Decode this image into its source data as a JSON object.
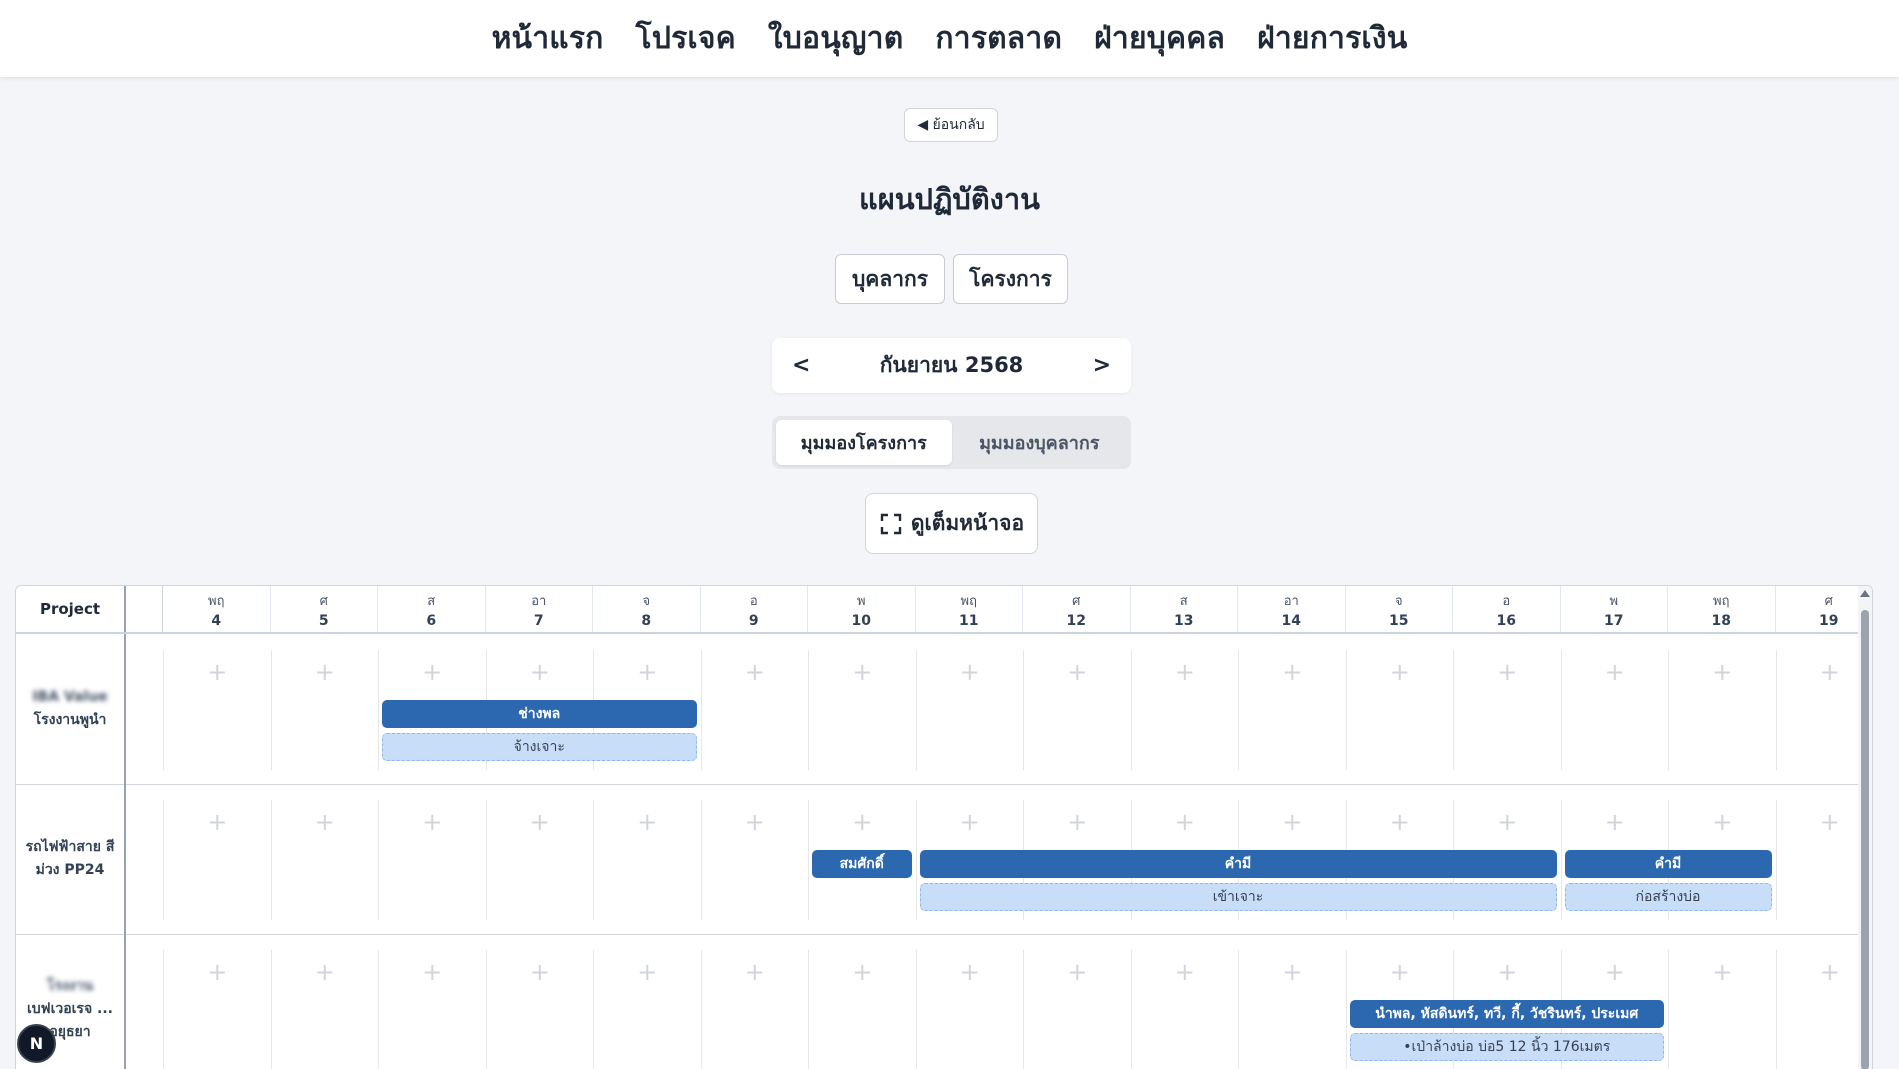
{
  "nav": [
    "หน้าแรก",
    "โปรเจค",
    "ใบอนุญาต",
    "การตลาด",
    "ฝ่ายบุคคล",
    "ฝ่ายการเงิน"
  ],
  "back_label": "◀ ย้อนกลับ",
  "page_title": "แผนปฏิบัติงาน",
  "tabs": [
    "บุคลากร",
    "โครงการ"
  ],
  "month": {
    "prev": "<",
    "label": "กันยายน 2568",
    "next": ">"
  },
  "view_toggle": {
    "active": "มุมมองโครงการ",
    "inactive": "มุมมองบุคลากร"
  },
  "fullscreen_label": "ดูเต็มหน้าจอ",
  "calendar": {
    "project_header": "Project",
    "days": [
      {
        "name": "พฤ",
        "date": "4"
      },
      {
        "name": "ศ",
        "date": "5"
      },
      {
        "name": "ส",
        "date": "6"
      },
      {
        "name": "อา",
        "date": "7"
      },
      {
        "name": "จ",
        "date": "8"
      },
      {
        "name": "อ",
        "date": "9"
      },
      {
        "name": "พ",
        "date": "10"
      },
      {
        "name": "พฤ",
        "date": "11"
      },
      {
        "name": "ศ",
        "date": "12"
      },
      {
        "name": "ส",
        "date": "13"
      },
      {
        "name": "อา",
        "date": "14"
      },
      {
        "name": "จ",
        "date": "15"
      },
      {
        "name": "อ",
        "date": "16"
      },
      {
        "name": "พ",
        "date": "17"
      },
      {
        "name": "พฤ",
        "date": "18"
      },
      {
        "name": "ศ",
        "date": "19"
      }
    ],
    "rows": [
      {
        "label_blurred": "IBA Value",
        "label": "โรงงานพูนำ",
        "events": [
          {
            "start_day": "6",
            "end_day": "8",
            "people": "ช่างพล",
            "task": "จ้างเจาะ"
          }
        ]
      },
      {
        "label_blurred": "",
        "label": "รถไฟฟ้าสาย สีม่วง PP24",
        "events": [
          {
            "start_day": "10",
            "end_day": "10",
            "people": "สมศักดิ์",
            "task": ""
          },
          {
            "start_day": "11",
            "end_day": "16",
            "people": "คำมี",
            "task": "เข้าเจาะ"
          },
          {
            "start_day": "17",
            "end_day": "18",
            "people": "คำมี",
            "task": "ก่อสร้างบ่อ"
          }
        ]
      },
      {
        "label_blurred": "โรงงาน",
        "label": "เบฟเวอเรจ ... อยุธยา",
        "events": [
          {
            "start_day": "15",
            "end_day": "17",
            "people": "นำพล, หัสดินทร์, ทวี, กี้, วัชรินทร์, ประเมศ",
            "task": "•เป่าล้างบ่อ บ่อ5 12 นิ้ว 176เมตร"
          }
        ]
      }
    ]
  },
  "badge": "N"
}
